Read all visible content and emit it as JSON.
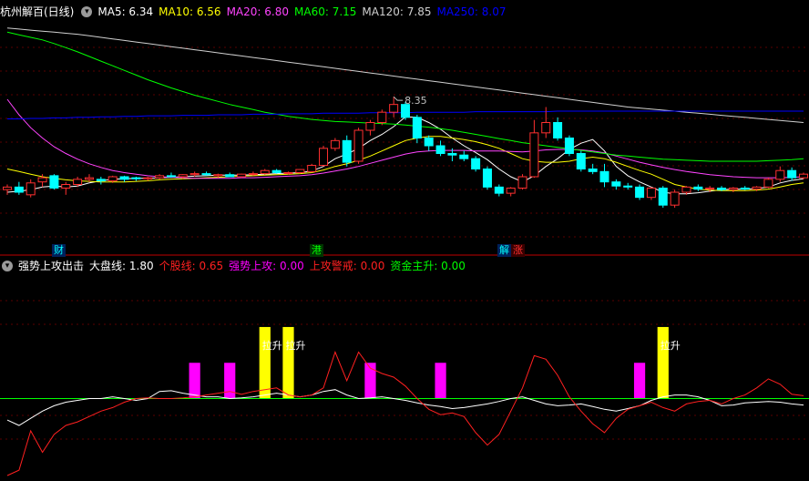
{
  "main_legend": {
    "title": "杭州解百(日线)",
    "title_color": "#ffffff",
    "items": [
      {
        "label": "MA5: 6.34",
        "color": "#ffffff"
      },
      {
        "label": "MA10: 6.56",
        "color": "#ffff00"
      },
      {
        "label": "MA20: 6.80",
        "color": "#ff44ff"
      },
      {
        "label": "MA60: 7.15",
        "color": "#00ff00"
      },
      {
        "label": "MA120: 7.85",
        "color": "#d0d0d0"
      },
      {
        "label": "MA250: 8.07",
        "color": "#0000ff"
      }
    ]
  },
  "sub_legend": {
    "title": "强势上攻出击",
    "items": [
      {
        "label": "大盘线: 1.80",
        "color": "#ffffff"
      },
      {
        "label": "个股线: 0.65",
        "color": "#ff2020"
      },
      {
        "label": "强势上攻: 0.00",
        "color": "#ff00ff"
      },
      {
        "label": "上攻警戒: 0.00",
        "color": "#ff2020"
      },
      {
        "label": "资金主升: 0.00",
        "color": "#00ff00"
      }
    ]
  },
  "event_tags": [
    {
      "text": "财",
      "color": "#00ffff",
      "bg": "#00205a"
    },
    {
      "text": "港",
      "color": "#00ff00",
      "bg": "#003300"
    },
    {
      "text": "解",
      "color": "#00ffff",
      "bg": "#00205a"
    },
    {
      "text": "涨",
      "color": "#ff3030",
      "bg": "#3a0000"
    }
  ],
  "chart_data": [
    {
      "type": "candlestick",
      "title": "杭州解百(日线)",
      "annotation": "8.35",
      "peak_value": 8.35,
      "up_color": "#ff3030",
      "down_color": "#00ffff",
      "candles": [
        [
          6.55,
          6.65,
          6.45,
          6.6
        ],
        [
          6.6,
          6.7,
          6.45,
          6.5
        ],
        [
          6.45,
          6.75,
          6.4,
          6.68
        ],
        [
          6.7,
          6.85,
          6.6,
          6.78
        ],
        [
          6.82,
          6.85,
          6.55,
          6.58
        ],
        [
          6.58,
          6.7,
          6.45,
          6.65
        ],
        [
          6.65,
          6.8,
          6.6,
          6.75
        ],
        [
          6.75,
          6.85,
          6.7,
          6.78
        ],
        [
          6.75,
          6.8,
          6.65,
          6.72
        ],
        [
          6.72,
          6.82,
          6.68,
          6.8
        ],
        [
          6.8,
          6.82,
          6.7,
          6.75
        ],
        [
          6.78,
          6.8,
          6.72,
          6.76
        ],
        [
          6.76,
          6.8,
          6.72,
          6.78
        ],
        [
          6.78,
          6.85,
          6.75,
          6.82
        ],
        [
          6.82,
          6.88,
          6.78,
          6.8
        ],
        [
          6.8,
          6.85,
          6.76,
          6.84
        ],
        [
          6.84,
          6.9,
          6.8,
          6.86
        ],
        [
          6.86,
          6.9,
          6.82,
          6.84
        ],
        [
          6.82,
          6.86,
          6.78,
          6.84
        ],
        [
          6.84,
          6.88,
          6.8,
          6.8
        ],
        [
          6.8,
          6.86,
          6.78,
          6.85
        ],
        [
          6.85,
          6.9,
          6.82,
          6.86
        ],
        [
          6.86,
          6.95,
          6.84,
          6.92
        ],
        [
          6.92,
          6.95,
          6.86,
          6.88
        ],
        [
          6.88,
          6.9,
          6.84,
          6.88
        ],
        [
          6.88,
          6.95,
          6.86,
          6.94
        ],
        [
          6.9,
          7.05,
          6.88,
          7.02
        ],
        [
          7.02,
          7.4,
          7.0,
          7.35
        ],
        [
          7.35,
          7.55,
          7.3,
          7.5
        ],
        [
          7.5,
          7.6,
          7.0,
          7.08
        ],
        [
          7.1,
          7.75,
          7.05,
          7.7
        ],
        [
          7.7,
          7.9,
          7.6,
          7.85
        ],
        [
          7.85,
          8.1,
          7.8,
          8.05
        ],
        [
          8.05,
          8.35,
          7.95,
          8.2
        ],
        [
          8.2,
          8.25,
          7.9,
          7.95
        ],
        [
          7.95,
          8.0,
          7.45,
          7.55
        ],
        [
          7.55,
          7.6,
          7.3,
          7.4
        ],
        [
          7.4,
          7.5,
          7.2,
          7.25
        ],
        [
          7.25,
          7.35,
          7.1,
          7.22
        ],
        [
          7.22,
          7.3,
          7.1,
          7.15
        ],
        [
          7.15,
          7.2,
          6.9,
          6.95
        ],
        [
          6.95,
          7.0,
          6.55,
          6.6
        ],
        [
          6.6,
          6.65,
          6.42,
          6.48
        ],
        [
          6.48,
          6.6,
          6.42,
          6.58
        ],
        [
          6.58,
          6.85,
          6.55,
          6.8
        ],
        [
          6.8,
          7.9,
          6.78,
          7.65
        ],
        [
          7.65,
          8.15,
          7.55,
          7.85
        ],
        [
          7.85,
          7.95,
          7.5,
          7.55
        ],
        [
          7.55,
          7.6,
          7.2,
          7.25
        ],
        [
          7.25,
          7.3,
          6.9,
          6.95
        ],
        [
          6.95,
          7.05,
          6.85,
          6.9
        ],
        [
          6.9,
          7.05,
          6.6,
          6.7
        ],
        [
          6.7,
          6.75,
          6.55,
          6.62
        ],
        [
          6.62,
          6.68,
          6.55,
          6.6
        ],
        [
          6.6,
          6.65,
          6.35,
          6.4
        ],
        [
          6.4,
          6.6,
          6.35,
          6.58
        ],
        [
          6.58,
          6.62,
          6.2,
          6.25
        ],
        [
          6.25,
          6.55,
          6.2,
          6.5
        ],
        [
          6.5,
          6.62,
          6.45,
          6.6
        ],
        [
          6.6,
          6.65,
          6.52,
          6.56
        ],
        [
          6.56,
          6.62,
          6.5,
          6.58
        ],
        [
          6.58,
          6.62,
          6.52,
          6.55
        ],
        [
          6.55,
          6.6,
          6.5,
          6.58
        ],
        [
          6.58,
          6.62,
          6.54,
          6.56
        ],
        [
          6.56,
          6.62,
          6.52,
          6.6
        ],
        [
          6.6,
          6.78,
          6.58,
          6.75
        ],
        [
          6.75,
          7.0,
          6.7,
          6.92
        ],
        [
          6.92,
          6.98,
          6.72,
          6.78
        ],
        [
          6.78,
          6.88,
          6.75,
          6.85
        ]
      ],
      "ma": [
        {
          "name": "MA5",
          "color": "#ffffff",
          "values": [
            6.5,
            6.52,
            6.55,
            6.6,
            6.62,
            6.6,
            6.62,
            6.68,
            6.72,
            6.75,
            6.76,
            6.77,
            6.77,
            6.78,
            6.79,
            6.8,
            6.81,
            6.82,
            6.83,
            6.83,
            6.83,
            6.84,
            6.85,
            6.86,
            6.87,
            6.88,
            6.91,
            7.0,
            7.15,
            7.24,
            7.35,
            7.5,
            7.62,
            7.77,
            7.96,
            7.95,
            7.85,
            7.72,
            7.55,
            7.4,
            7.27,
            7.13,
            6.95,
            6.8,
            6.7,
            6.82,
            7.0,
            7.15,
            7.33,
            7.45,
            7.52,
            7.3,
            7.0,
            6.82,
            6.7,
            6.6,
            6.5,
            6.47,
            6.47,
            6.49,
            6.52,
            6.55,
            6.56,
            6.56,
            6.57,
            6.6,
            6.68,
            6.73,
            6.76
          ]
        },
        {
          "name": "MA10",
          "color": "#ffff00",
          "values": [
            6.95,
            6.9,
            6.85,
            6.8,
            6.77,
            6.74,
            6.72,
            6.71,
            6.7,
            6.7,
            6.7,
            6.71,
            6.72,
            6.74,
            6.75,
            6.76,
            6.77,
            6.78,
            6.79,
            6.8,
            6.81,
            6.82,
            6.83,
            6.84,
            6.85,
            6.86,
            6.88,
            6.93,
            7.0,
            7.05,
            7.12,
            7.2,
            7.3,
            7.4,
            7.5,
            7.55,
            7.58,
            7.58,
            7.55,
            7.52,
            7.48,
            7.42,
            7.35,
            7.25,
            7.15,
            7.1,
            7.08,
            7.08,
            7.1,
            7.15,
            7.18,
            7.15,
            7.08,
            7.0,
            6.92,
            6.85,
            6.75,
            6.65,
            6.6,
            6.56,
            6.54,
            6.53,
            6.53,
            6.53,
            6.54,
            6.56,
            6.6,
            6.65,
            6.68
          ]
        },
        {
          "name": "MA20",
          "color": "#ff44ff",
          "values": [
            8.3,
            8.0,
            7.75,
            7.55,
            7.38,
            7.25,
            7.14,
            7.05,
            6.98,
            6.92,
            6.88,
            6.85,
            6.82,
            6.8,
            6.79,
            6.78,
            6.77,
            6.77,
            6.77,
            6.77,
            6.78,
            6.78,
            6.79,
            6.8,
            6.81,
            6.82,
            6.84,
            6.87,
            6.91,
            6.95,
            7.0,
            7.06,
            7.12,
            7.18,
            7.24,
            7.28,
            7.3,
            7.31,
            7.31,
            7.31,
            7.3,
            7.3,
            7.3,
            7.29,
            7.28,
            7.3,
            7.32,
            7.33,
            7.33,
            7.32,
            7.3,
            7.26,
            7.2,
            7.14,
            7.08,
            7.03,
            6.98,
            6.94,
            6.9,
            6.87,
            6.84,
            6.82,
            6.8,
            6.79,
            6.78,
            6.78,
            6.78,
            6.79,
            6.8
          ]
        },
        {
          "name": "MA60",
          "color": "#00ff00",
          "values": [
            9.6,
            9.55,
            9.5,
            9.45,
            9.38,
            9.3,
            9.22,
            9.13,
            9.04,
            8.95,
            8.86,
            8.77,
            8.68,
            8.6,
            8.52,
            8.45,
            8.38,
            8.32,
            8.26,
            8.2,
            8.15,
            8.1,
            8.05,
            8.01,
            7.97,
            7.94,
            7.91,
            7.89,
            7.87,
            7.86,
            7.85,
            7.84,
            7.83,
            7.82,
            7.8,
            7.78,
            7.76,
            7.73,
            7.7,
            7.66,
            7.62,
            7.58,
            7.54,
            7.5,
            7.46,
            7.43,
            7.4,
            7.37,
            7.34,
            7.31,
            7.28,
            7.25,
            7.22,
            7.2,
            7.18,
            7.16,
            7.14,
            7.13,
            7.12,
            7.11,
            7.1,
            7.1,
            7.1,
            7.1,
            7.1,
            7.11,
            7.12,
            7.13,
            7.15
          ]
        },
        {
          "name": "MA120",
          "color": "#d0d0d0",
          "values": [
            9.68,
            9.66,
            9.64,
            9.62,
            9.6,
            9.58,
            9.56,
            9.53,
            9.5,
            9.47,
            9.44,
            9.41,
            9.38,
            9.35,
            9.32,
            9.29,
            9.26,
            9.23,
            9.2,
            9.17,
            9.14,
            9.11,
            9.08,
            9.05,
            9.02,
            8.99,
            8.96,
            8.93,
            8.9,
            8.87,
            8.84,
            8.81,
            8.78,
            8.75,
            8.72,
            8.69,
            8.66,
            8.63,
            8.6,
            8.57,
            8.54,
            8.51,
            8.48,
            8.45,
            8.42,
            8.39,
            8.36,
            8.33,
            8.3,
            8.27,
            8.24,
            8.21,
            8.18,
            8.15,
            8.13,
            8.11,
            8.09,
            8.07,
            8.05,
            8.03,
            8.01,
            7.99,
            7.97,
            7.95,
            7.93,
            7.91,
            7.89,
            7.87,
            7.85
          ]
        },
        {
          "name": "MA250",
          "color": "#0000ff",
          "values": [
            7.92,
            7.92,
            7.93,
            7.93,
            7.94,
            7.94,
            7.95,
            7.95,
            7.96,
            7.96,
            7.97,
            7.97,
            7.98,
            7.98,
            7.98,
            7.99,
            7.99,
            7.99,
            8.0,
            8.0,
            8.0,
            8.01,
            8.01,
            8.01,
            8.02,
            8.02,
            8.02,
            8.03,
            8.03,
            8.03,
            8.03,
            8.04,
            8.04,
            8.04,
            8.04,
            8.05,
            8.05,
            8.05,
            8.05,
            8.05,
            8.06,
            8.06,
            8.06,
            8.06,
            8.06,
            8.06,
            8.06,
            8.07,
            8.07,
            8.07,
            8.07,
            8.07,
            8.07,
            8.07,
            8.07,
            8.07,
            8.07,
            8.07,
            8.07,
            8.07,
            8.07,
            8.07,
            8.07,
            8.07,
            8.07,
            8.07,
            8.07,
            8.07,
            8.07
          ]
        }
      ]
    },
    {
      "type": "line",
      "title": "强势上攻出击",
      "n": 69,
      "ylim": [
        -2.2,
        3.5
      ],
      "series": [
        {
          "name": "大盘线",
          "color": "#ffffff",
          "values": [
            -0.6,
            -0.75,
            -0.55,
            -0.35,
            -0.2,
            -0.1,
            -0.05,
            0.0,
            0.0,
            0.05,
            0.0,
            -0.05,
            0.0,
            0.2,
            0.22,
            0.15,
            0.1,
            0.05,
            0.05,
            0.0,
            0.02,
            0.05,
            0.1,
            0.15,
            0.1,
            0.05,
            0.1,
            0.2,
            0.25,
            0.1,
            0.0,
            0.02,
            0.05,
            0.0,
            -0.05,
            -0.12,
            -0.18,
            -0.22,
            -0.28,
            -0.25,
            -0.2,
            -0.15,
            -0.08,
            0.0,
            0.05,
            -0.05,
            -0.15,
            -0.2,
            -0.18,
            -0.15,
            -0.22,
            -0.3,
            -0.35,
            -0.28,
            -0.2,
            -0.05,
            0.05,
            0.1,
            0.1,
            0.05,
            -0.05,
            -0.2,
            -0.18,
            -0.12,
            -0.1,
            -0.08,
            -0.1,
            -0.15,
            -0.18
          ]
        },
        {
          "name": "个股线",
          "color": "#ff2020",
          "values": [
            -2.15,
            -2.0,
            -0.9,
            -1.5,
            -1.0,
            -0.75,
            -0.65,
            -0.5,
            -0.35,
            -0.25,
            -0.1,
            0.0,
            0.02,
            0.0,
            0.0,
            0.02,
            0.05,
            0.1,
            0.15,
            0.2,
            0.12,
            0.2,
            0.25,
            0.3,
            0.1,
            0.05,
            0.1,
            0.3,
            1.3,
            0.5,
            1.3,
            0.85,
            0.7,
            0.6,
            0.35,
            0.0,
            -0.3,
            -0.45,
            -0.4,
            -0.5,
            -0.95,
            -1.3,
            -1.0,
            -0.35,
            0.3,
            1.2,
            1.1,
            0.65,
            0.05,
            -0.35,
            -0.7,
            -0.95,
            -0.55,
            -0.3,
            -0.2,
            -0.1,
            -0.25,
            -0.35,
            -0.15,
            -0.08,
            -0.05,
            -0.15,
            0.0,
            0.1,
            0.3,
            0.55,
            0.4,
            0.12,
            0.08
          ]
        }
      ],
      "bars": [
        {
          "index": 16,
          "value": 1.0,
          "color": "#ff00ff"
        },
        {
          "index": 19,
          "value": 1.0,
          "color": "#ff00ff"
        },
        {
          "index": 31,
          "value": 1.0,
          "color": "#ff00ff"
        },
        {
          "index": 37,
          "value": 1.0,
          "color": "#ff00ff"
        },
        {
          "index": 54,
          "value": 1.0,
          "color": "#ff00ff"
        },
        {
          "index": 22,
          "value": 2.0,
          "color": "#ffff00",
          "label": "拉升"
        },
        {
          "index": 24,
          "value": 2.0,
          "color": "#ffff00",
          "label": "拉升"
        },
        {
          "index": 56,
          "value": 2.0,
          "color": "#ffff00",
          "label": "拉升"
        }
      ],
      "baseline_value": 0,
      "baseline_color": "#00ff00"
    }
  ]
}
